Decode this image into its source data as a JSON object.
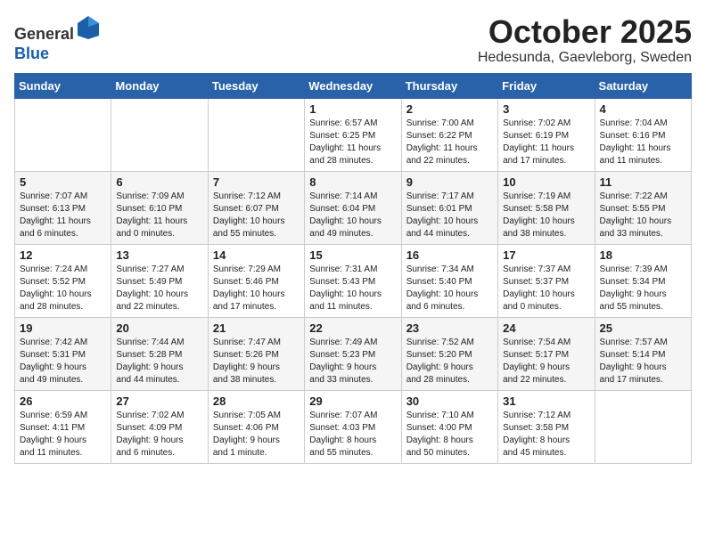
{
  "header": {
    "logo_line1": "General",
    "logo_line2": "Blue",
    "month": "October 2025",
    "location": "Hedesunda, Gaevleborg, Sweden"
  },
  "weekdays": [
    "Sunday",
    "Monday",
    "Tuesday",
    "Wednesday",
    "Thursday",
    "Friday",
    "Saturday"
  ],
  "weeks": [
    [
      {
        "day": "",
        "info": ""
      },
      {
        "day": "",
        "info": ""
      },
      {
        "day": "",
        "info": ""
      },
      {
        "day": "1",
        "info": "Sunrise: 6:57 AM\nSunset: 6:25 PM\nDaylight: 11 hours\nand 28 minutes."
      },
      {
        "day": "2",
        "info": "Sunrise: 7:00 AM\nSunset: 6:22 PM\nDaylight: 11 hours\nand 22 minutes."
      },
      {
        "day": "3",
        "info": "Sunrise: 7:02 AM\nSunset: 6:19 PM\nDaylight: 11 hours\nand 17 minutes."
      },
      {
        "day": "4",
        "info": "Sunrise: 7:04 AM\nSunset: 6:16 PM\nDaylight: 11 hours\nand 11 minutes."
      }
    ],
    [
      {
        "day": "5",
        "info": "Sunrise: 7:07 AM\nSunset: 6:13 PM\nDaylight: 11 hours\nand 6 minutes."
      },
      {
        "day": "6",
        "info": "Sunrise: 7:09 AM\nSunset: 6:10 PM\nDaylight: 11 hours\nand 0 minutes."
      },
      {
        "day": "7",
        "info": "Sunrise: 7:12 AM\nSunset: 6:07 PM\nDaylight: 10 hours\nand 55 minutes."
      },
      {
        "day": "8",
        "info": "Sunrise: 7:14 AM\nSunset: 6:04 PM\nDaylight: 10 hours\nand 49 minutes."
      },
      {
        "day": "9",
        "info": "Sunrise: 7:17 AM\nSunset: 6:01 PM\nDaylight: 10 hours\nand 44 minutes."
      },
      {
        "day": "10",
        "info": "Sunrise: 7:19 AM\nSunset: 5:58 PM\nDaylight: 10 hours\nand 38 minutes."
      },
      {
        "day": "11",
        "info": "Sunrise: 7:22 AM\nSunset: 5:55 PM\nDaylight: 10 hours\nand 33 minutes."
      }
    ],
    [
      {
        "day": "12",
        "info": "Sunrise: 7:24 AM\nSunset: 5:52 PM\nDaylight: 10 hours\nand 28 minutes."
      },
      {
        "day": "13",
        "info": "Sunrise: 7:27 AM\nSunset: 5:49 PM\nDaylight: 10 hours\nand 22 minutes."
      },
      {
        "day": "14",
        "info": "Sunrise: 7:29 AM\nSunset: 5:46 PM\nDaylight: 10 hours\nand 17 minutes."
      },
      {
        "day": "15",
        "info": "Sunrise: 7:31 AM\nSunset: 5:43 PM\nDaylight: 10 hours\nand 11 minutes."
      },
      {
        "day": "16",
        "info": "Sunrise: 7:34 AM\nSunset: 5:40 PM\nDaylight: 10 hours\nand 6 minutes."
      },
      {
        "day": "17",
        "info": "Sunrise: 7:37 AM\nSunset: 5:37 PM\nDaylight: 10 hours\nand 0 minutes."
      },
      {
        "day": "18",
        "info": "Sunrise: 7:39 AM\nSunset: 5:34 PM\nDaylight: 9 hours\nand 55 minutes."
      }
    ],
    [
      {
        "day": "19",
        "info": "Sunrise: 7:42 AM\nSunset: 5:31 PM\nDaylight: 9 hours\nand 49 minutes."
      },
      {
        "day": "20",
        "info": "Sunrise: 7:44 AM\nSunset: 5:28 PM\nDaylight: 9 hours\nand 44 minutes."
      },
      {
        "day": "21",
        "info": "Sunrise: 7:47 AM\nSunset: 5:26 PM\nDaylight: 9 hours\nand 38 minutes."
      },
      {
        "day": "22",
        "info": "Sunrise: 7:49 AM\nSunset: 5:23 PM\nDaylight: 9 hours\nand 33 minutes."
      },
      {
        "day": "23",
        "info": "Sunrise: 7:52 AM\nSunset: 5:20 PM\nDaylight: 9 hours\nand 28 minutes."
      },
      {
        "day": "24",
        "info": "Sunrise: 7:54 AM\nSunset: 5:17 PM\nDaylight: 9 hours\nand 22 minutes."
      },
      {
        "day": "25",
        "info": "Sunrise: 7:57 AM\nSunset: 5:14 PM\nDaylight: 9 hours\nand 17 minutes."
      }
    ],
    [
      {
        "day": "26",
        "info": "Sunrise: 6:59 AM\nSunset: 4:11 PM\nDaylight: 9 hours\nand 11 minutes."
      },
      {
        "day": "27",
        "info": "Sunrise: 7:02 AM\nSunset: 4:09 PM\nDaylight: 9 hours\nand 6 minutes."
      },
      {
        "day": "28",
        "info": "Sunrise: 7:05 AM\nSunset: 4:06 PM\nDaylight: 9 hours\nand 1 minute."
      },
      {
        "day": "29",
        "info": "Sunrise: 7:07 AM\nSunset: 4:03 PM\nDaylight: 8 hours\nand 55 minutes."
      },
      {
        "day": "30",
        "info": "Sunrise: 7:10 AM\nSunset: 4:00 PM\nDaylight: 8 hours\nand 50 minutes."
      },
      {
        "day": "31",
        "info": "Sunrise: 7:12 AM\nSunset: 3:58 PM\nDaylight: 8 hours\nand 45 minutes."
      },
      {
        "day": "",
        "info": ""
      }
    ]
  ]
}
